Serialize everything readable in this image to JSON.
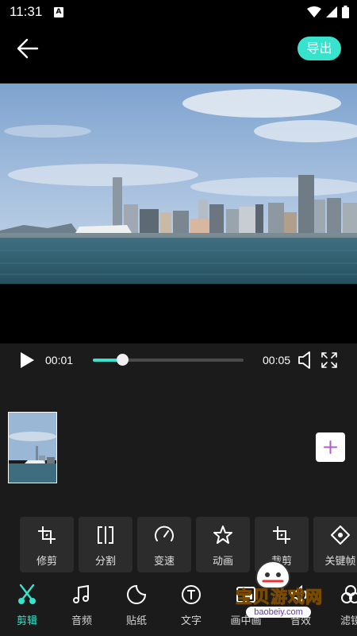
{
  "status_bar": {
    "time": "11:31",
    "notification_icon": "A",
    "icons": [
      "wifi-icon",
      "signal-icon",
      "battery-icon"
    ]
  },
  "header": {
    "back_icon": "arrow-left-icon",
    "export_label": "导出"
  },
  "player": {
    "current_time": "00:01",
    "duration": "00:05",
    "progress": 0.2,
    "icons": [
      "play-icon",
      "volume-icon",
      "fullscreen-icon"
    ]
  },
  "timeline": {
    "clip_icon": "video-thumbnail",
    "add_icon": "plus-icon"
  },
  "tools": [
    {
      "label": "修剪",
      "icon": "trim-icon"
    },
    {
      "label": "分割",
      "icon": "split-icon"
    },
    {
      "label": "变速",
      "icon": "speed-icon"
    },
    {
      "label": "动画",
      "icon": "star-icon"
    },
    {
      "label": "裁剪",
      "icon": "crop-icon"
    },
    {
      "label": "关键帧",
      "icon": "keyframe-icon"
    }
  ],
  "nav": [
    {
      "label": "剪辑",
      "icon": "scissors-icon",
      "active": true
    },
    {
      "label": "音频",
      "icon": "music-icon"
    },
    {
      "label": "贴纸",
      "icon": "sticker-icon"
    },
    {
      "label": "文字",
      "icon": "text-icon"
    },
    {
      "label": "画中画",
      "icon": "pip-icon"
    },
    {
      "label": "音效",
      "icon": "sound-icon"
    },
    {
      "label": "滤镜",
      "icon": "filter-icon"
    }
  ],
  "watermark": {
    "title": "宝贝游戏网",
    "url": "baobeiy.com"
  },
  "colors": {
    "accent": "#37e3cd",
    "panel": "#1b1b1b",
    "tool_bg": "#2c2c2c",
    "add_plus": "#b05cc8"
  }
}
